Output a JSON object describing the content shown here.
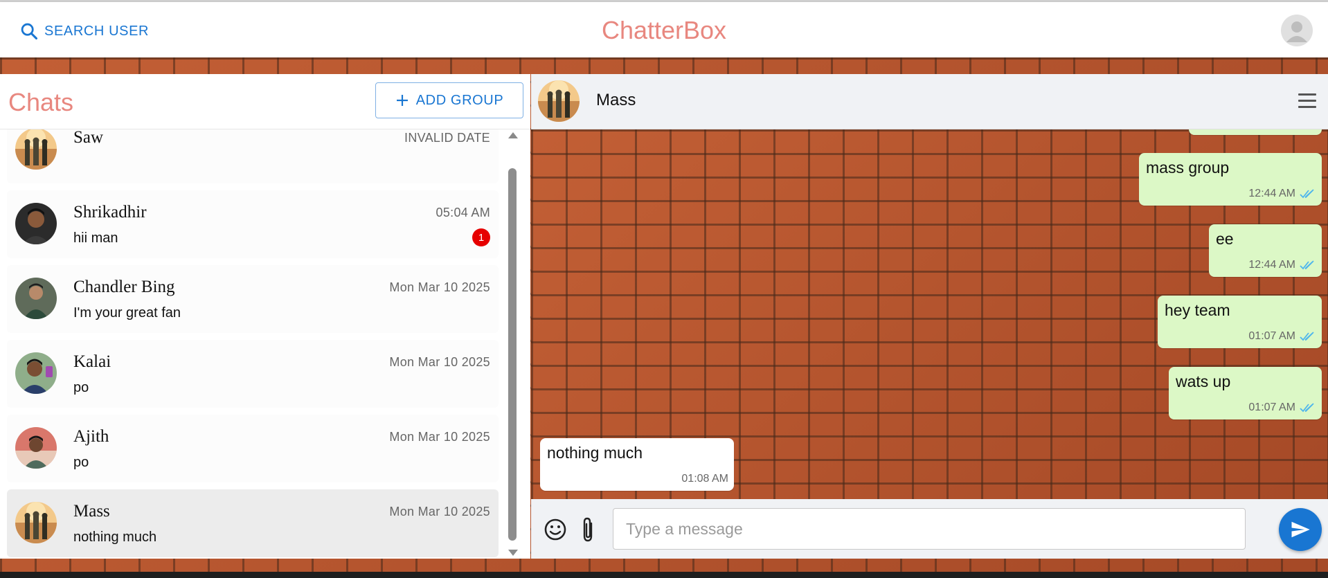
{
  "header": {
    "search_label": "SEARCH USER",
    "app_title": "ChatterBox"
  },
  "chats": {
    "title": "Chats",
    "add_group_label": "ADD GROUP",
    "items": [
      {
        "name": "Saw",
        "date": "INVALID DATE",
        "message": "",
        "unread": ""
      },
      {
        "name": "Shrikadhir",
        "date": "05:04 AM",
        "message": "hii man",
        "unread": "1"
      },
      {
        "name": "Chandler Bing",
        "date": "Mon Mar 10 2025",
        "message": "I'm your great fan",
        "unread": ""
      },
      {
        "name": "Kalai",
        "date": "Mon Mar 10 2025",
        "message": "po",
        "unread": ""
      },
      {
        "name": "Ajith",
        "date": "Mon Mar 10 2025",
        "message": "po",
        "unread": ""
      },
      {
        "name": "Mass",
        "date": "Mon Mar 10 2025",
        "message": "nothing much",
        "unread": ""
      }
    ]
  },
  "conversation": {
    "name": "Mass",
    "messages": [
      {
        "text": "mass group",
        "time": "12:44 AM",
        "direction": "out"
      },
      {
        "text": "ee",
        "time": "12:44 AM",
        "direction": "out"
      },
      {
        "text": "hey team",
        "time": "01:07 AM",
        "direction": "out"
      },
      {
        "text": "wats up",
        "time": "01:07 AM",
        "direction": "out"
      },
      {
        "text": "nothing much",
        "time": "01:08 AM",
        "direction": "in"
      }
    ],
    "input_placeholder": "Type a message"
  },
  "colors": {
    "accent": "#1976d2",
    "brand_title": "#e8877f",
    "outgoing_bubble": "#dcf8c6",
    "unread_badge": "#e60000",
    "read_ticks": "#4fb6ec"
  },
  "icons": {
    "search": "search-icon",
    "profile": "user-avatar-icon",
    "add": "plus-icon",
    "menu": "hamburger-menu-icon",
    "emoji": "smiley-icon",
    "attach": "paperclip-icon",
    "send": "send-icon",
    "read": "double-check-icon"
  }
}
